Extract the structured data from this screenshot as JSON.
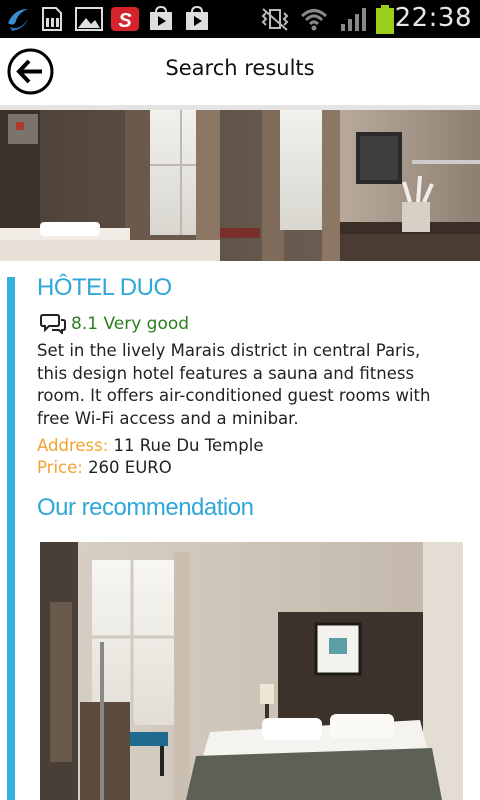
{
  "status_bar": {
    "time": "22:38",
    "icons": [
      "app-icon",
      "sd-card-icon",
      "gallery-icon",
      "s-app-icon",
      "play-store-icon",
      "play-store-icon",
      "vibrate-icon",
      "wifi-icon",
      "signal-icon",
      "battery-icon"
    ]
  },
  "header": {
    "title": "Search results",
    "back_icon": "back-arrow-icon"
  },
  "hotel": {
    "name": "HÔTEL DUO",
    "rating": "8.1 Very good",
    "description": "Set in the lively Marais district in central Paris, this design hotel features a sauna and fitness room. It offers air-conditioned guest rooms with free Wi-Fi access and a minibar.",
    "address_label": "Address:",
    "address_value": "11 Rue Du Temple",
    "price_label": "Price:",
    "price_value": "260 EURO"
  },
  "recommendation": {
    "title": "Our recommendation"
  },
  "colors": {
    "accent_blue": "#36b0dd",
    "rating_green": "#2c7d1e",
    "label_orange": "#f4a231"
  }
}
